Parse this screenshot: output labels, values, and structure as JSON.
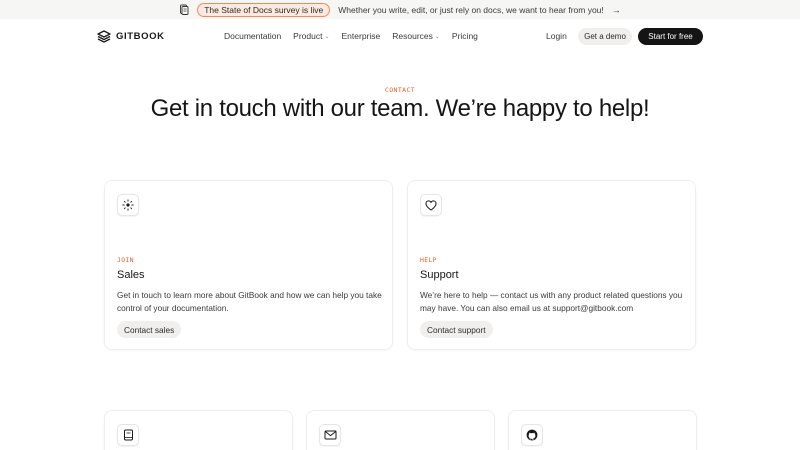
{
  "announcement": {
    "badge": "The State of Docs survey is live",
    "text": "Whether you write, edit, or just rely on docs, we want to hear from you!",
    "arrow": "→"
  },
  "nav": {
    "brand": "GITBOOK",
    "items": [
      {
        "label": "Documentation",
        "has_dropdown": false
      },
      {
        "label": "Product",
        "has_dropdown": true
      },
      {
        "label": "Enterprise",
        "has_dropdown": false
      },
      {
        "label": "Resources",
        "has_dropdown": true
      },
      {
        "label": "Pricing",
        "has_dropdown": false
      }
    ],
    "login": "Login",
    "demo": "Get a demo",
    "start": "Start for free"
  },
  "hero": {
    "eyebrow": "CONTACT",
    "title": "Get in touch with our team. We’re happy to help!"
  },
  "cards": [
    {
      "icon": "sparkle-icon",
      "tag": "JOIN",
      "title": "Sales",
      "description": "Get in touch to learn more about GitBook and how we can help you take control of your documentation.",
      "button": "Contact sales"
    },
    {
      "icon": "heart-icon",
      "tag": "HELP",
      "title": "Support",
      "description": "We’re here to help — contact us with any product related questions you may have. You can also email us at support@gitbook.com",
      "button": "Contact support"
    }
  ],
  "small_cards": [
    {
      "icon": "book-icon"
    },
    {
      "icon": "mail-icon"
    },
    {
      "icon": "github-icon"
    }
  ],
  "colors": {
    "accent": "#e8602c",
    "badge_border": "#f08a5d",
    "badge_bg": "#fde9df",
    "dark_button": "#141414",
    "light_button": "#f0efed"
  }
}
